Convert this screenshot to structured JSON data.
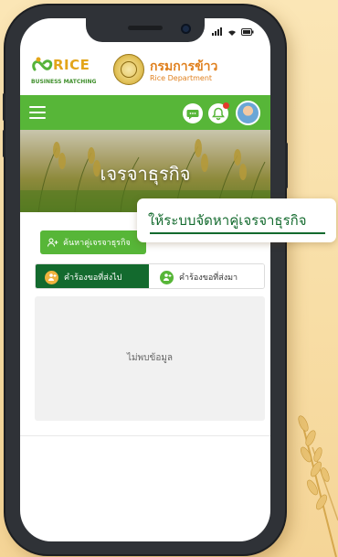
{
  "branding": {
    "logo_word": "RICE",
    "logo_subtitle": "BUSINESS MATCHING",
    "department_th": "กรมการข้าว",
    "department_en": "Rice Department"
  },
  "nav": {
    "menu_icon": "hamburger-icon",
    "chat_icon": "chat-icon",
    "notification_icon": "bell-icon",
    "notification_badge_color": "#e43a2b",
    "profile_icon": "avatar"
  },
  "banner": {
    "title": "เจรจาธุรกิจ"
  },
  "actions": {
    "find_partner_label": "ค้นหาคู่เจรจาธุรกิจ",
    "find_partner_icon": "add-user-icon"
  },
  "callout": {
    "text": "ให้ระบบจัดหาคู่เจรจาธุรกิจ"
  },
  "tabs": [
    {
      "label": "คำร้องขอที่ส่งไป",
      "active": true,
      "icon": "user-send-icon"
    },
    {
      "label": "คำร้องขอที่ส่งมา",
      "active": false,
      "icon": "user-receive-icon"
    }
  ],
  "content": {
    "empty_message": "ไม่พบข้อมูล"
  },
  "colors": {
    "brand_green": "#57b638",
    "dark_green": "#136a2e",
    "brand_orange": "#e0801e",
    "background": "#fbe6b6"
  }
}
